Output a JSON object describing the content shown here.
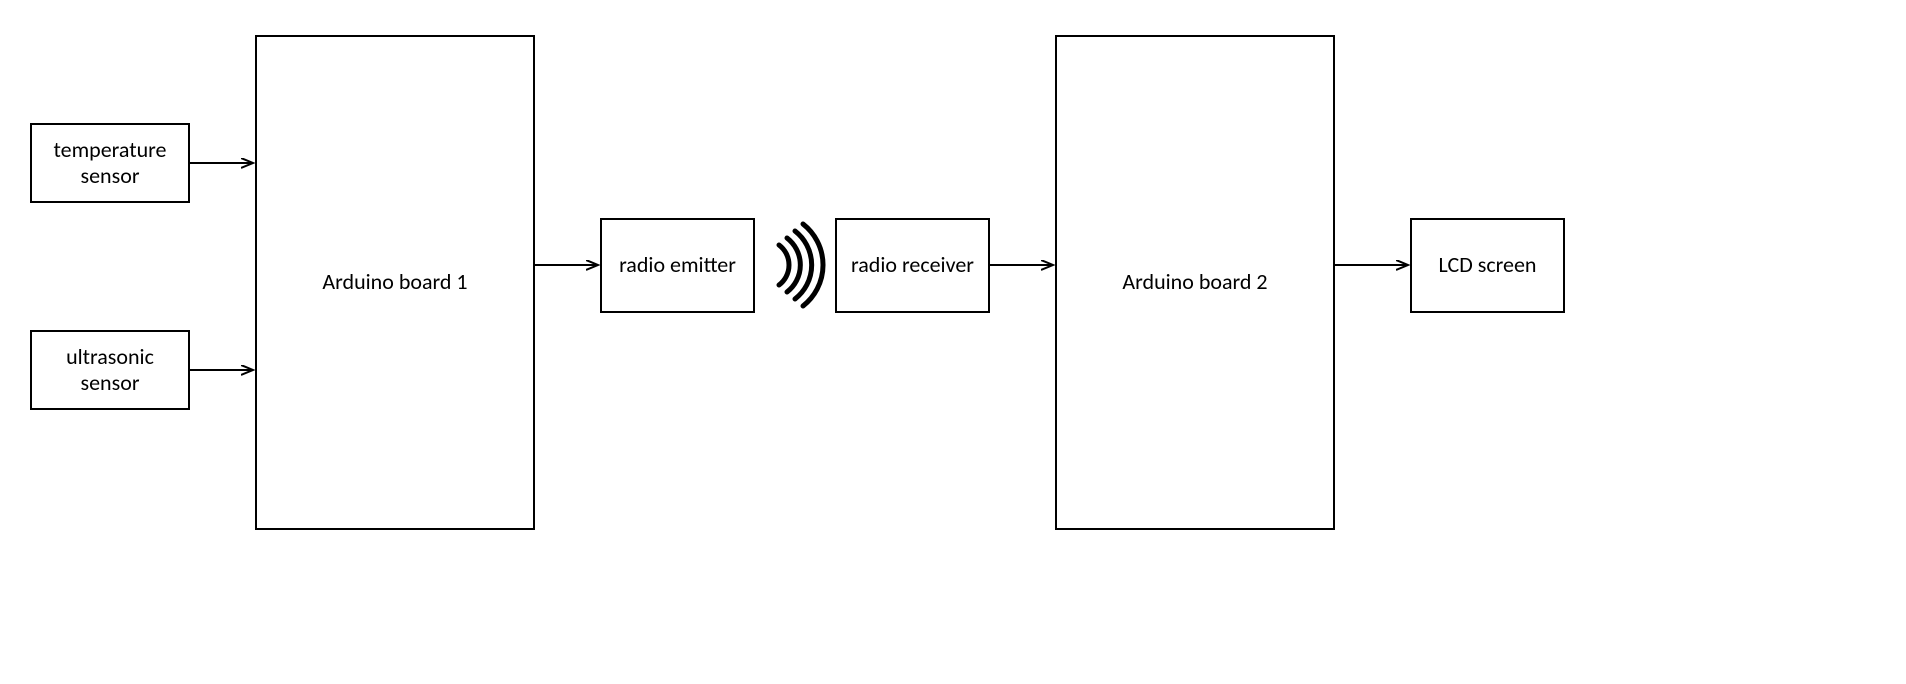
{
  "diagram": {
    "nodes": {
      "temperature_sensor": {
        "label": "temperature sensor"
      },
      "ultrasonic_sensor": {
        "label": "ultrasonic sensor"
      },
      "arduino1": {
        "label": "Arduino board 1"
      },
      "radio_emitter": {
        "label": "radio emitter"
      },
      "radio_receiver": {
        "label": "radio receiver"
      },
      "arduino2": {
        "label": "Arduino board 2"
      },
      "lcd_screen": {
        "label": "LCD screen"
      }
    },
    "edges": [
      {
        "from": "temperature_sensor",
        "to": "arduino1",
        "kind": "arrow"
      },
      {
        "from": "ultrasonic_sensor",
        "to": "arduino1",
        "kind": "arrow"
      },
      {
        "from": "arduino1",
        "to": "radio_emitter",
        "kind": "arrow"
      },
      {
        "from": "radio_emitter",
        "to": "radio_receiver",
        "kind": "wireless"
      },
      {
        "from": "radio_receiver",
        "to": "arduino2",
        "kind": "arrow"
      },
      {
        "from": "arduino2",
        "to": "lcd_screen",
        "kind": "arrow"
      }
    ]
  }
}
